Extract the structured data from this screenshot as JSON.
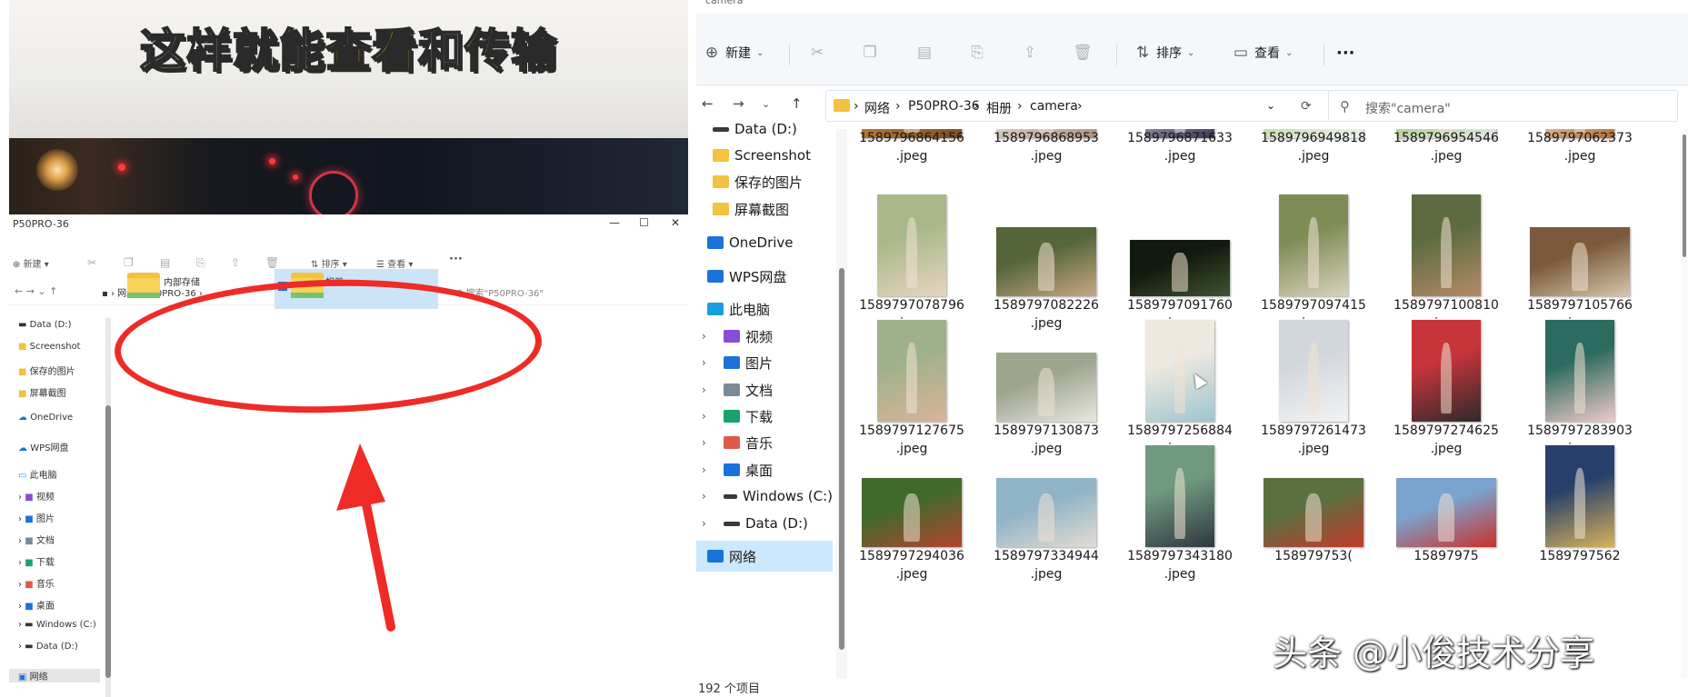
{
  "video": {
    "caption_white_1": "这样就能",
    "caption_yellow_1": "查看",
    "caption_white_2": "和",
    "caption_yellow_2": "传输",
    "small_window_title": "P50PRO-36",
    "small_window_controls": [
      "—",
      "☐",
      "✕"
    ],
    "small_toolbar": {
      "new": "新建",
      "sort": "排序",
      "view": "查看",
      "more": "···"
    },
    "small_breadcrumb": [
      "网络",
      "P50PRO-36"
    ],
    "small_search_placeholder": "搜索\"P50PRO-36\"",
    "small_nav": [
      "Data (D:)",
      "Screenshot",
      "保存的图片",
      "屏幕截图",
      "OneDrive",
      "WPS网盘",
      "此电脑",
      "视频",
      "图片",
      "文档",
      "下载",
      "音乐",
      "桌面",
      "Windows (C:)",
      "Data (D:)",
      "网络"
    ],
    "small_folders": [
      "内部存储",
      "相册"
    ],
    "annotation_color": "#ee2b26"
  },
  "explorer": {
    "window_title": "camera",
    "toolbar": {
      "new_label": "新建",
      "sort_label": "排序",
      "view_label": "查看",
      "more_label": "···"
    },
    "breadcrumb": [
      "网络",
      "P50PRO-36",
      "相册",
      "camera"
    ],
    "search_placeholder": "搜索\"camera\"",
    "nav": [
      {
        "label": "Data (D:)",
        "icon": "drive-icon"
      },
      {
        "label": "Screenshot",
        "icon": "folder-icon"
      },
      {
        "label": "保存的图片",
        "icon": "folder-icon"
      },
      {
        "label": "屏幕截图",
        "icon": "folder-icon"
      },
      {
        "label": "OneDrive",
        "icon": "cloud-icon"
      },
      {
        "label": "WPS网盘",
        "icon": "cloud-icon"
      },
      {
        "label": "此电脑",
        "icon": "pc-icon"
      },
      {
        "label": "视频",
        "icon": "video-icon"
      },
      {
        "label": "图片",
        "icon": "pictures-icon"
      },
      {
        "label": "文档",
        "icon": "documents-icon"
      },
      {
        "label": "下载",
        "icon": "download-icon"
      },
      {
        "label": "音乐",
        "icon": "music-icon"
      },
      {
        "label": "桌面",
        "icon": "desktop-icon"
      },
      {
        "label": "Windows (C:)",
        "icon": "drive-icon"
      },
      {
        "label": "Data (D:)",
        "icon": "drive-icon"
      },
      {
        "label": "网络",
        "icon": "network-icon"
      }
    ],
    "files": [
      {
        "name": "1589796864156",
        "ext": ".jpeg",
        "c1": "#c98a3a",
        "c2": "#7a4a22"
      },
      {
        "name": "1589796868953",
        "ext": ".jpeg",
        "c1": "#e8e4dc",
        "c2": "#a88e78"
      },
      {
        "name": "1589796871633",
        "ext": ".jpeg",
        "c1": "#b3bdbf",
        "c2": "#3c2f59"
      },
      {
        "name": "1589796949818",
        "ext": ".jpeg",
        "c1": "#bcd79a",
        "c2": "#f0f3f2"
      },
      {
        "name": "1589796954546",
        "ext": ".jpeg",
        "c1": "#a7c97a",
        "c2": "#e5ebe7"
      },
      {
        "name": "1589797062373",
        "ext": ".jpeg",
        "c1": "#efe2c8",
        "c2": "#b3692f"
      },
      {
        "name": "1589797078796",
        "ext": ".jpeg",
        "c1": "#a9b889",
        "c2": "#e7d5bf"
      },
      {
        "name": "1589797082226",
        "ext": ".jpeg",
        "c1": "#56653a",
        "c2": "#c8a787"
      },
      {
        "name": "1589797091760",
        "ext": ".jpeg",
        "c1": "#12190f",
        "c2": "#3f5330"
      },
      {
        "name": "1589797097415",
        "ext": ".jpeg",
        "c1": "#7e8d56",
        "c2": "#d9d1bd"
      },
      {
        "name": "1589797100810",
        "ext": ".jpeg",
        "c1": "#5e6b40",
        "c2": "#b48a68"
      },
      {
        "name": "1589797105766",
        "ext": ".jpeg",
        "c1": "#7a5a3a",
        "c2": "#d6c6ae"
      },
      {
        "name": "1589797127675",
        "ext": ".jpeg",
        "c1": "#9fb18a",
        "c2": "#d9b49a"
      },
      {
        "name": "1589797130873",
        "ext": ".jpeg",
        "c1": "#9ea58f",
        "c2": "#e8e8e0"
      },
      {
        "name": "1589797256884",
        "ext": ".jpeg",
        "c1": "#eee9e0",
        "c2": "#9dc5d0"
      },
      {
        "name": "1589797261473",
        "ext": ".jpeg",
        "c1": "#d2d7de",
        "c2": "#f2f2f2"
      },
      {
        "name": "1589797274625",
        "ext": ".jpeg",
        "c1": "#c7343a",
        "c2": "#2e2a2b"
      },
      {
        "name": "1589797283903",
        "ext": ".jpeg",
        "c1": "#2c6b5f",
        "c2": "#f1c9c9"
      },
      {
        "name": "1589797294036",
        "ext": ".jpeg",
        "c1": "#3f6a2c",
        "c2": "#b4442f"
      },
      {
        "name": "1589797334944",
        "ext": ".jpeg",
        "c1": "#8fb3c7",
        "c2": "#e2dcd2"
      },
      {
        "name": "1589797343180",
        "ext": ".jpeg",
        "c1": "#6f9a7f",
        "c2": "#2f3742"
      },
      {
        "name": "158979753(",
        "ext": "",
        "c1": "#5a7040",
        "c2": "#c33b2c"
      },
      {
        "name": "15897975",
        "ext": "",
        "c1": "#7ba3cf",
        "c2": "#c9312a"
      },
      {
        "name": "1589797562",
        "ext": "",
        "c1": "#26406b",
        "c2": "#d9b15a"
      }
    ],
    "status": "192 个项目"
  },
  "watermark": "头条 @小俊技术分享"
}
